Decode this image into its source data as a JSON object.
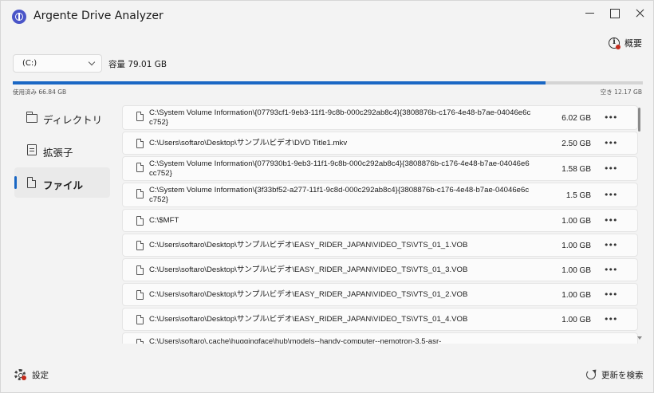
{
  "app": {
    "title": "Argente Drive Analyzer",
    "accent_color": "#1a67c4",
    "icon": "app-logo-icon"
  },
  "window_controls": {
    "minimize": "minimize-icon",
    "maximize": "maximize-icon",
    "close": "close-icon"
  },
  "header": {
    "overview_label": "概要",
    "overview_icon": "info-icon"
  },
  "drive": {
    "selected": "(C:)",
    "capacity_label": "容量 79.01 GB",
    "used_label": "使用済み 66.84 GB",
    "free_label": "空き 12.17 GB",
    "used_fraction": 0.846
  },
  "nav": {
    "items": [
      {
        "label": "ディレクトリ",
        "icon": "folder-icon",
        "active": false
      },
      {
        "label": "拡張子",
        "icon": "extension-icon",
        "active": false
      },
      {
        "label": "ファイル",
        "icon": "file-icon",
        "active": true
      }
    ]
  },
  "files": [
    {
      "path": "C:\\System Volume Information\\{07793cf1-9eb3-11f1-9c8b-000c292ab8c4}{3808876b-c176-4e48-b7ae-04046e6cc752}",
      "size": "6.02 GB",
      "more": "•••"
    },
    {
      "path": "C:\\Users\\softaro\\Desktop\\サンプル\\ビデオ\\DVD Title1.mkv",
      "size": "2.50 GB",
      "more": "•••"
    },
    {
      "path": "C:\\System Volume Information\\{077930b1-9eb3-11f1-9c8b-000c292ab8c4}{3808876b-c176-4e48-b7ae-04046e6cc752}",
      "size": "1.58 GB",
      "more": "•••"
    },
    {
      "path": "C:\\System Volume Information\\{3f33bf52-a277-11f1-9c8d-000c292ab8c4}{3808876b-c176-4e48-b7ae-04046e6cc752}",
      "size": "1.5 GB",
      "more": "•••"
    },
    {
      "path": "C:\\$MFT",
      "size": "1.00 GB",
      "more": "•••"
    },
    {
      "path": "C:\\Users\\softaro\\Desktop\\サンプル\\ビデオ\\EASY_RIDER_JAPAN\\VIDEO_TS\\VTS_01_1.VOB",
      "size": "1.00 GB",
      "more": "•••"
    },
    {
      "path": "C:\\Users\\softaro\\Desktop\\サンプル\\ビデオ\\EASY_RIDER_JAPAN\\VIDEO_TS\\VTS_01_3.VOB",
      "size": "1.00 GB",
      "more": "•••"
    },
    {
      "path": "C:\\Users\\softaro\\Desktop\\サンプル\\ビデオ\\EASY_RIDER_JAPAN\\VIDEO_TS\\VTS_01_2.VOB",
      "size": "1.00 GB",
      "more": "•••"
    },
    {
      "path": "C:\\Users\\softaro\\Desktop\\サンプル\\ビデオ\\EASY_RIDER_JAPAN\\VIDEO_TS\\VTS_01_4.VOB",
      "size": "1.00 GB",
      "more": "•••"
    },
    {
      "path": "C:\\Users\\softaro\\.cache\\huggingface\\hub\\models--handy-computer--nemotron-3.5-asr-",
      "size": "",
      "more": ""
    }
  ],
  "footer": {
    "settings_label": "設定",
    "settings_icon": "gear-icon",
    "rescan_label": "更新を検索",
    "rescan_icon": "refresh-icon"
  }
}
